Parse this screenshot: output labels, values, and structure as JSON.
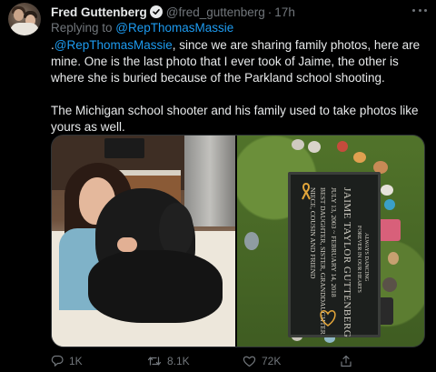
{
  "author": {
    "name": "Fred Guttenberg",
    "handle": "@fred_guttenberg",
    "separator": "·",
    "time": "17h"
  },
  "reply": {
    "prefix": "Replying to ",
    "mention": "@RepThomasMassie"
  },
  "tweet": {
    "lead": ".",
    "mention": "@RepThomasMassie",
    "text1": ", since we are sharing family photos, here are mine. One is the last photo that I ever took of Jaime, the other is where she is buried because of the Parkland school shooting.",
    "text2": "The Michigan school shooter and his family used to take photos like yours as well."
  },
  "plaque": {
    "line1": "JAIME TAYLOR GUTTENBERG",
    "line2": "JULY 13, 2003 ~ FEBRUARY 14, 2018",
    "line3": "BEST DAUGHTER, SISTER, GRANDDAUGHTER",
    "line4": "NIECE, COUSIN AND FRIEND",
    "top1": "ALWAYS DANCING",
    "top2": "FOREVER IN OUR HEARTS"
  },
  "actions": {
    "replies": "1K",
    "retweets": "8.1K",
    "likes": "72K"
  },
  "colors": {
    "background": "#000000",
    "text": "#e7e9ea",
    "muted": "#71767b",
    "link": "#1d9bf0"
  },
  "icons": [
    "verified-badge-icon",
    "more-options-icon",
    "reply-icon",
    "retweet-icon",
    "like-icon",
    "share-icon"
  ]
}
